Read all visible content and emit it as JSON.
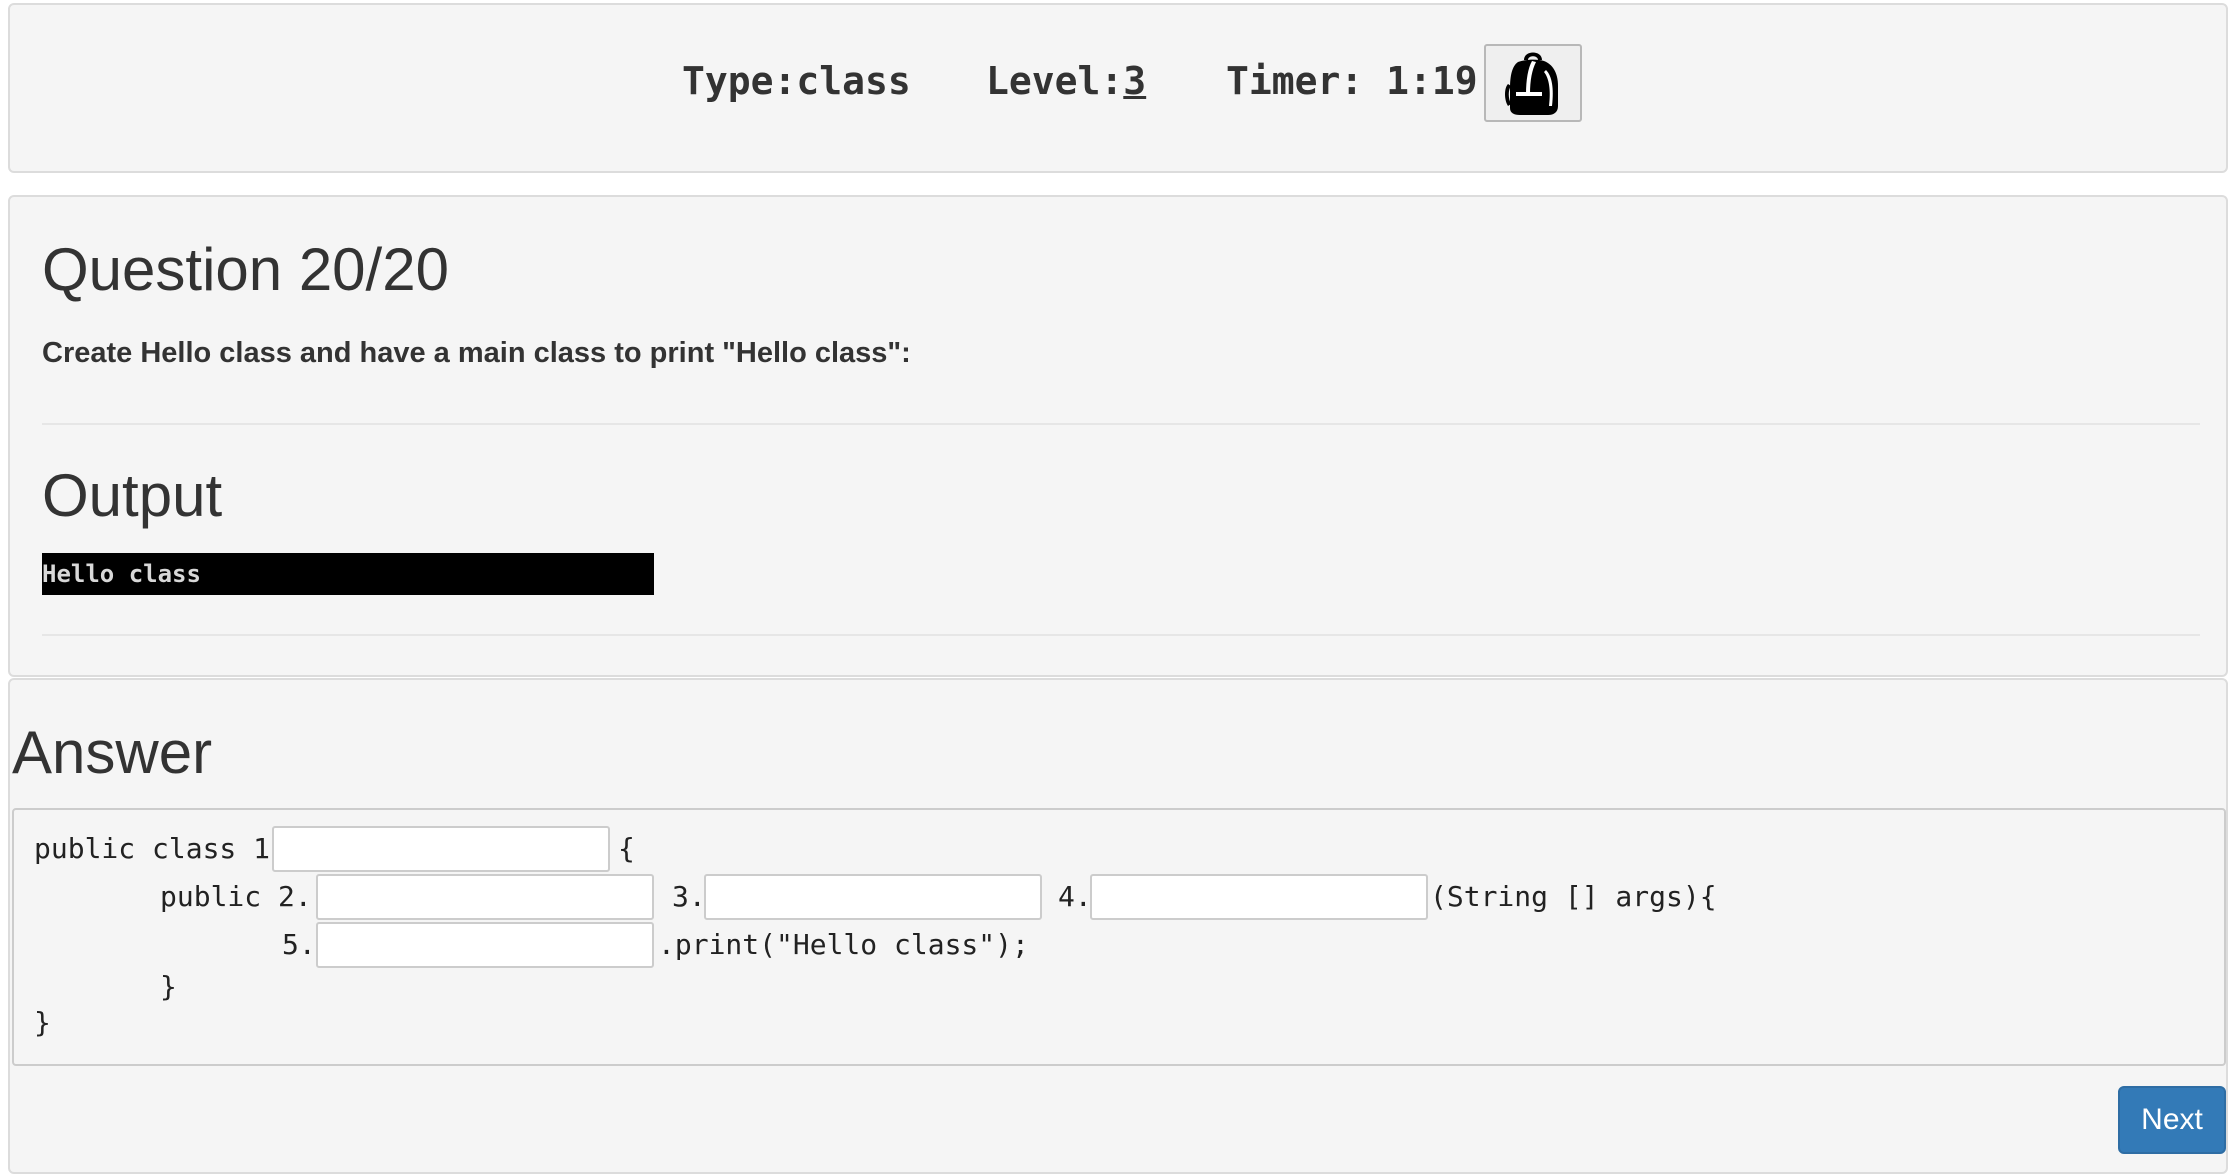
{
  "header": {
    "type_label": "Type:",
    "type_value": "class",
    "level_label": "Level:",
    "level_value": "3",
    "timer_label": "Timer: ",
    "timer_value": "1:19",
    "backpack_icon": "backpack-icon"
  },
  "question": {
    "title": "Question 20/20",
    "prompt": "Create Hello class and have a main class to print \"Hello class\":"
  },
  "output": {
    "title": "Output",
    "console_text": "Hello class"
  },
  "answer": {
    "title": "Answer",
    "code": {
      "line1_prefix": "public class 1.",
      "line1_suffix": "{",
      "line2_prefix": "public 2.",
      "marker3": "3.",
      "marker4": "4.",
      "line2_suffix": "(String [] args){",
      "marker5": "5.",
      "line3_suffix": ".print(\"Hello class\");",
      "close_inner": "}",
      "close_outer": "}"
    },
    "blanks": [
      {
        "value": "",
        "placeholder": ""
      },
      {
        "value": "",
        "placeholder": ""
      },
      {
        "value": "",
        "placeholder": ""
      },
      {
        "value": "",
        "placeholder": ""
      },
      {
        "value": "",
        "placeholder": ""
      }
    ]
  },
  "footer": {
    "next_label": "Next",
    "next_color": "#337ab7"
  }
}
